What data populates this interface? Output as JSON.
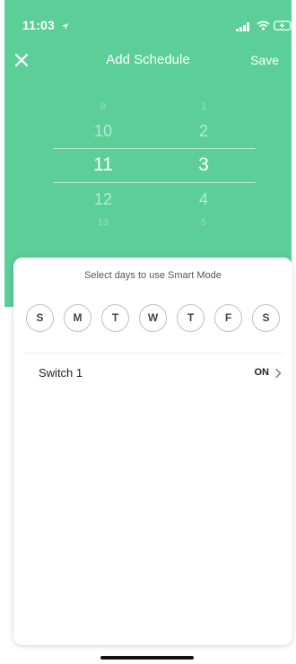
{
  "status_bar": {
    "time": "11:03",
    "icons": [
      "location-arrow-icon",
      "cellular-signal-icon",
      "wifi-icon",
      "battery-charging-icon"
    ]
  },
  "nav": {
    "close_icon": "close-icon",
    "title": "Add Schedule",
    "save_label": "Save"
  },
  "picker": {
    "hours": {
      "far_top": "9",
      "near_top": "10",
      "selected": "11",
      "near_bottom": "12",
      "far_bottom": "13"
    },
    "minutes": {
      "far_top": "1",
      "near_top": "2",
      "selected": "3",
      "near_bottom": "4",
      "far_bottom": "5"
    }
  },
  "sheet": {
    "caption": "Select days to use Smart Mode",
    "days": [
      "S",
      "M",
      "T",
      "W",
      "T",
      "F",
      "S"
    ],
    "switch": {
      "name": "Switch 1",
      "state": "ON",
      "chevron_icon": "chevron-right-icon"
    }
  },
  "colors": {
    "accent": "#5bcf97",
    "day_border": "#bfbfbf"
  }
}
